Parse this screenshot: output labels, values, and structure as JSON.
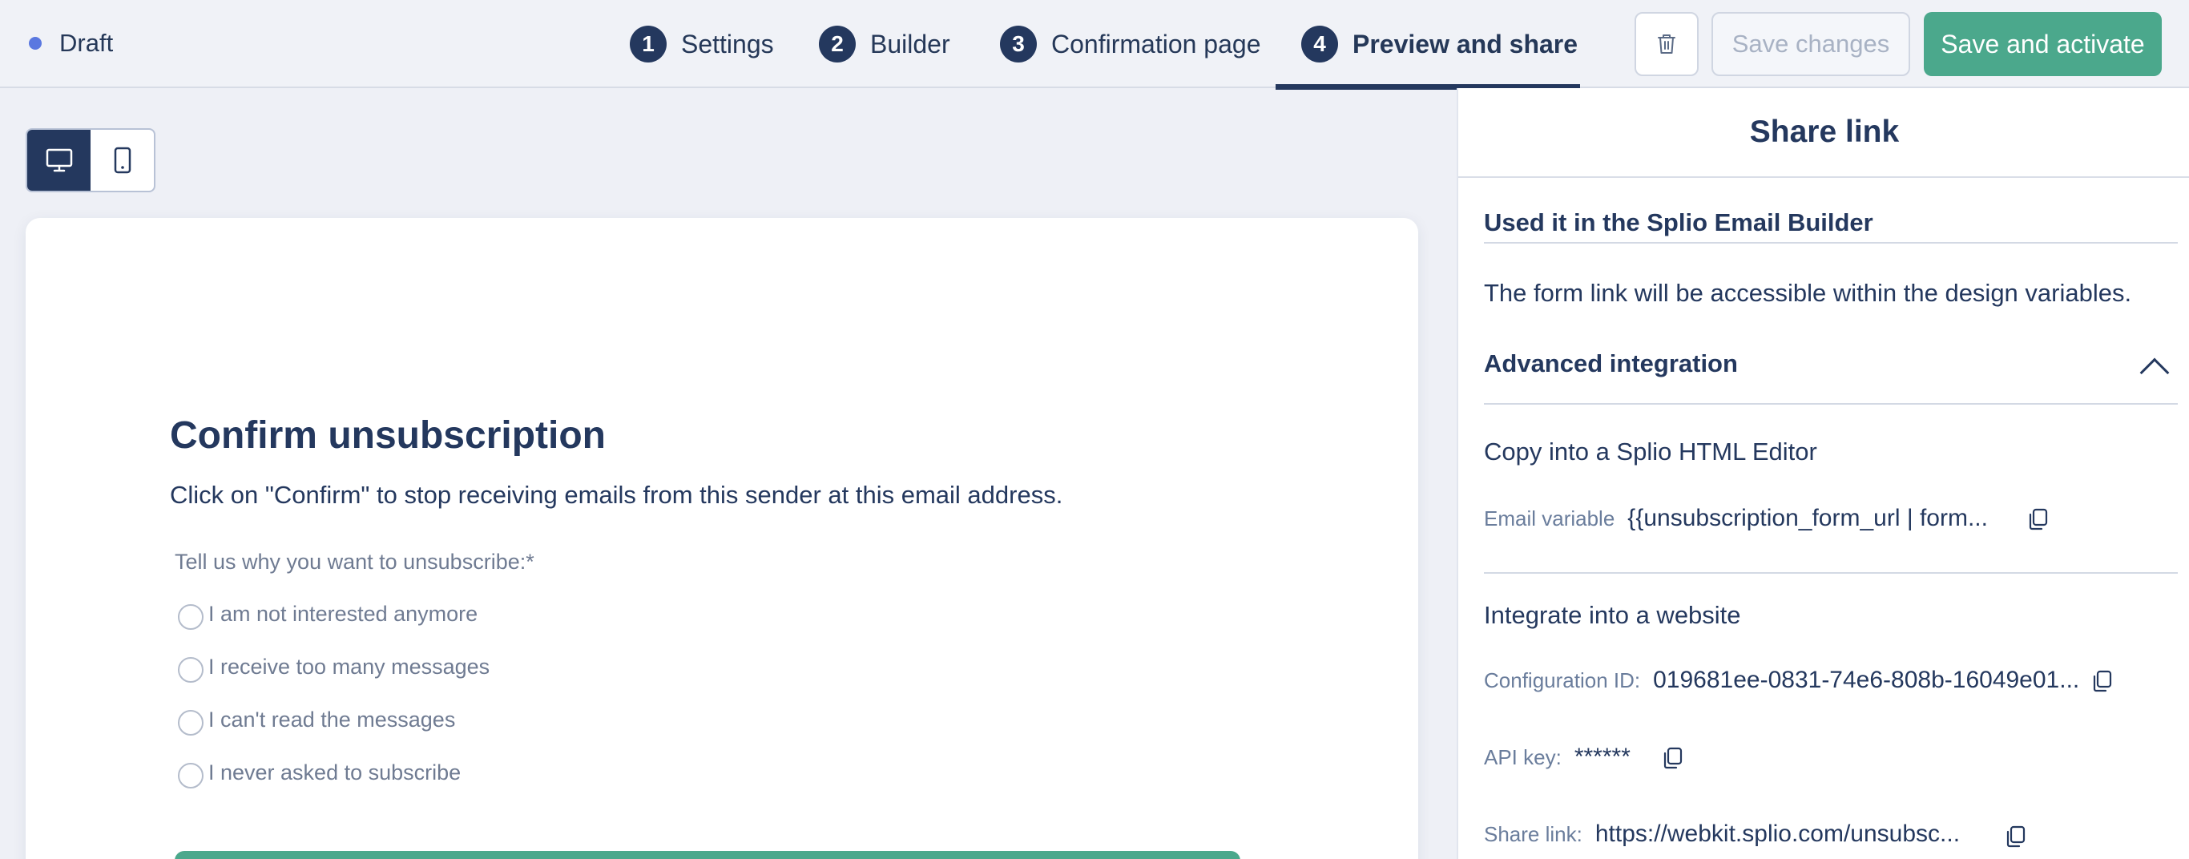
{
  "status": {
    "label": "Draft",
    "dot_color": "#5a78e0"
  },
  "steps": [
    {
      "num": "1",
      "label": "Settings"
    },
    {
      "num": "2",
      "label": "Builder"
    },
    {
      "num": "3",
      "label": "Confirmation page"
    },
    {
      "num": "4",
      "label": "Preview and share",
      "active": true
    }
  ],
  "toolbar": {
    "delete_icon": "trash-icon",
    "save_label": "Save changes",
    "activate_label": "Save and activate",
    "accent_color": "#4ba88c"
  },
  "device_toggle": {
    "desktop_icon": "desktop-icon",
    "mobile_icon": "mobile-icon",
    "selected": "desktop"
  },
  "form_preview": {
    "title": "Confirm unsubscription",
    "description": "Click on \"Confirm\" to stop receiving emails from this sender at this email address.",
    "question": "Tell us why you want to unsubscribe:*",
    "options": [
      "I am not interested anymore",
      "I receive too many messages",
      "I can't read the messages",
      "I never asked to subscribe"
    ]
  },
  "share_panel": {
    "title": "Share link",
    "email_builder_title": "Used it in the Splio Email Builder",
    "email_builder_text": "The form link will be accessible within the design variables.",
    "advanced_title": "Advanced integration",
    "html_editor_title": "Copy into a Splio HTML Editor",
    "email_variable_label": "Email variable",
    "email_variable_value": "{{unsubscription_form_url | form...",
    "website_title": "Integrate into a website",
    "config_id_label": "Configuration ID:",
    "config_id_value": "019681ee-0831-74e6-808b-16049e01...",
    "api_key_label": "API key:",
    "api_key_value": "******",
    "share_link_label": "Share link:",
    "share_link_value": "https://webkit.splio.com/unsubsc..."
  }
}
